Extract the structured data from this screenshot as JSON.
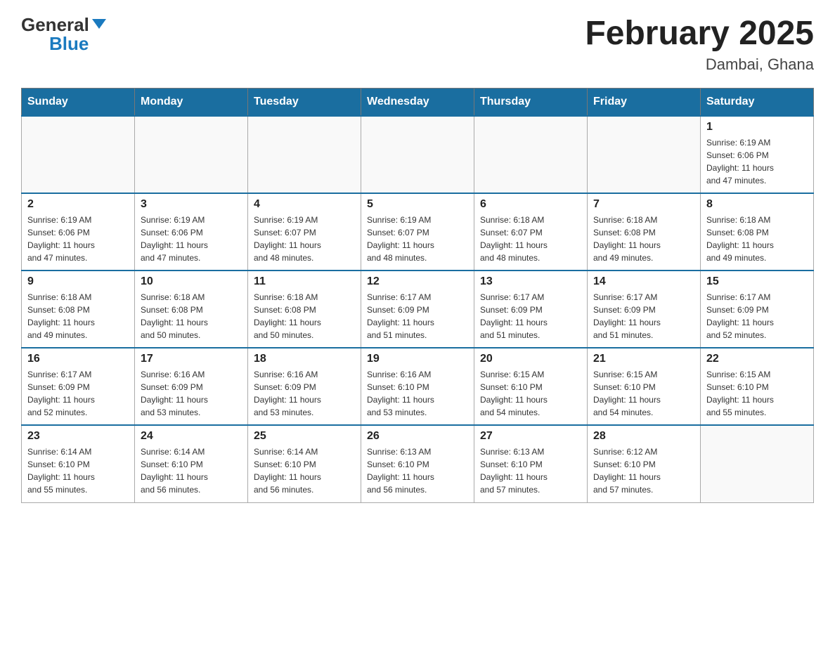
{
  "header": {
    "logo_general": "General",
    "logo_blue": "Blue",
    "title": "February 2025",
    "subtitle": "Dambai, Ghana"
  },
  "days_of_week": [
    "Sunday",
    "Monday",
    "Tuesday",
    "Wednesday",
    "Thursday",
    "Friday",
    "Saturday"
  ],
  "weeks": [
    [
      {
        "day": "",
        "info": ""
      },
      {
        "day": "",
        "info": ""
      },
      {
        "day": "",
        "info": ""
      },
      {
        "day": "",
        "info": ""
      },
      {
        "day": "",
        "info": ""
      },
      {
        "day": "",
        "info": ""
      },
      {
        "day": "1",
        "info": "Sunrise: 6:19 AM\nSunset: 6:06 PM\nDaylight: 11 hours\nand 47 minutes."
      }
    ],
    [
      {
        "day": "2",
        "info": "Sunrise: 6:19 AM\nSunset: 6:06 PM\nDaylight: 11 hours\nand 47 minutes."
      },
      {
        "day": "3",
        "info": "Sunrise: 6:19 AM\nSunset: 6:06 PM\nDaylight: 11 hours\nand 47 minutes."
      },
      {
        "day": "4",
        "info": "Sunrise: 6:19 AM\nSunset: 6:07 PM\nDaylight: 11 hours\nand 48 minutes."
      },
      {
        "day": "5",
        "info": "Sunrise: 6:19 AM\nSunset: 6:07 PM\nDaylight: 11 hours\nand 48 minutes."
      },
      {
        "day": "6",
        "info": "Sunrise: 6:18 AM\nSunset: 6:07 PM\nDaylight: 11 hours\nand 48 minutes."
      },
      {
        "day": "7",
        "info": "Sunrise: 6:18 AM\nSunset: 6:08 PM\nDaylight: 11 hours\nand 49 minutes."
      },
      {
        "day": "8",
        "info": "Sunrise: 6:18 AM\nSunset: 6:08 PM\nDaylight: 11 hours\nand 49 minutes."
      }
    ],
    [
      {
        "day": "9",
        "info": "Sunrise: 6:18 AM\nSunset: 6:08 PM\nDaylight: 11 hours\nand 49 minutes."
      },
      {
        "day": "10",
        "info": "Sunrise: 6:18 AM\nSunset: 6:08 PM\nDaylight: 11 hours\nand 50 minutes."
      },
      {
        "day": "11",
        "info": "Sunrise: 6:18 AM\nSunset: 6:08 PM\nDaylight: 11 hours\nand 50 minutes."
      },
      {
        "day": "12",
        "info": "Sunrise: 6:17 AM\nSunset: 6:09 PM\nDaylight: 11 hours\nand 51 minutes."
      },
      {
        "day": "13",
        "info": "Sunrise: 6:17 AM\nSunset: 6:09 PM\nDaylight: 11 hours\nand 51 minutes."
      },
      {
        "day": "14",
        "info": "Sunrise: 6:17 AM\nSunset: 6:09 PM\nDaylight: 11 hours\nand 51 minutes."
      },
      {
        "day": "15",
        "info": "Sunrise: 6:17 AM\nSunset: 6:09 PM\nDaylight: 11 hours\nand 52 minutes."
      }
    ],
    [
      {
        "day": "16",
        "info": "Sunrise: 6:17 AM\nSunset: 6:09 PM\nDaylight: 11 hours\nand 52 minutes."
      },
      {
        "day": "17",
        "info": "Sunrise: 6:16 AM\nSunset: 6:09 PM\nDaylight: 11 hours\nand 53 minutes."
      },
      {
        "day": "18",
        "info": "Sunrise: 6:16 AM\nSunset: 6:09 PM\nDaylight: 11 hours\nand 53 minutes."
      },
      {
        "day": "19",
        "info": "Sunrise: 6:16 AM\nSunset: 6:10 PM\nDaylight: 11 hours\nand 53 minutes."
      },
      {
        "day": "20",
        "info": "Sunrise: 6:15 AM\nSunset: 6:10 PM\nDaylight: 11 hours\nand 54 minutes."
      },
      {
        "day": "21",
        "info": "Sunrise: 6:15 AM\nSunset: 6:10 PM\nDaylight: 11 hours\nand 54 minutes."
      },
      {
        "day": "22",
        "info": "Sunrise: 6:15 AM\nSunset: 6:10 PM\nDaylight: 11 hours\nand 55 minutes."
      }
    ],
    [
      {
        "day": "23",
        "info": "Sunrise: 6:14 AM\nSunset: 6:10 PM\nDaylight: 11 hours\nand 55 minutes."
      },
      {
        "day": "24",
        "info": "Sunrise: 6:14 AM\nSunset: 6:10 PM\nDaylight: 11 hours\nand 56 minutes."
      },
      {
        "day": "25",
        "info": "Sunrise: 6:14 AM\nSunset: 6:10 PM\nDaylight: 11 hours\nand 56 minutes."
      },
      {
        "day": "26",
        "info": "Sunrise: 6:13 AM\nSunset: 6:10 PM\nDaylight: 11 hours\nand 56 minutes."
      },
      {
        "day": "27",
        "info": "Sunrise: 6:13 AM\nSunset: 6:10 PM\nDaylight: 11 hours\nand 57 minutes."
      },
      {
        "day": "28",
        "info": "Sunrise: 6:12 AM\nSunset: 6:10 PM\nDaylight: 11 hours\nand 57 minutes."
      },
      {
        "day": "",
        "info": ""
      }
    ]
  ]
}
